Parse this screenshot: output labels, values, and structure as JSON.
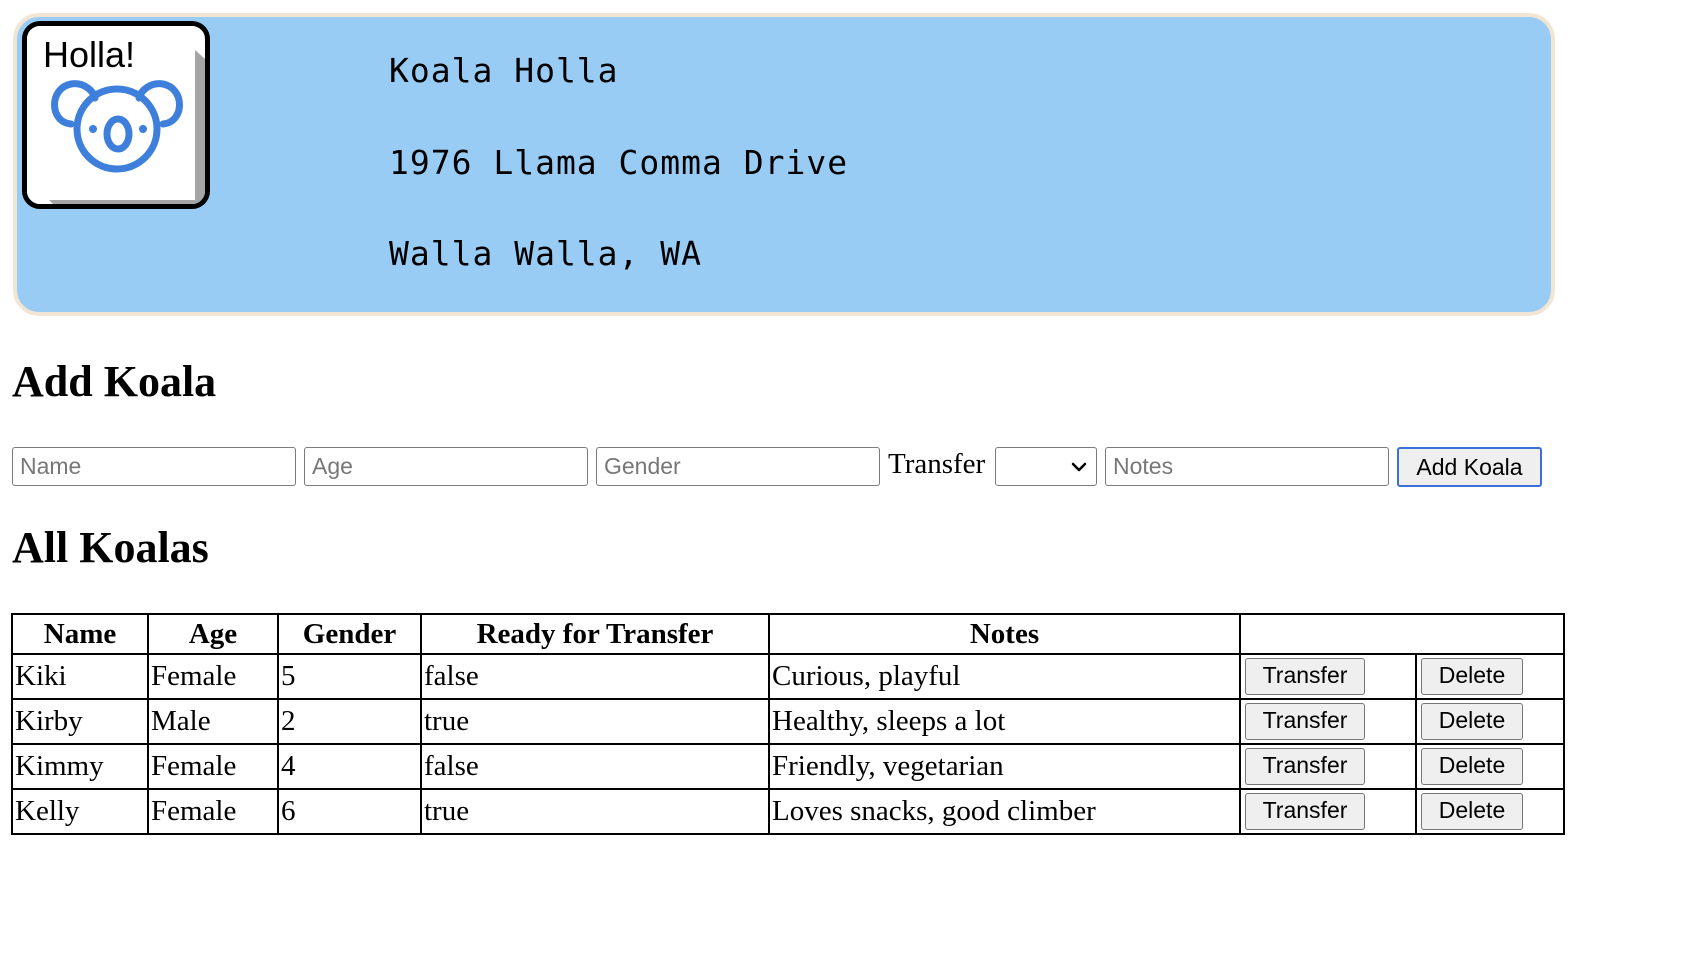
{
  "header": {
    "logo_text": "Holla!",
    "name": "Koala Holla",
    "street": "1976 Llama Comma Drive",
    "city": "Walla Walla, WA",
    "colors": {
      "banner": "#99ccf5",
      "border": "#f3e5d6",
      "koala": "#3f7fdc"
    }
  },
  "add_form": {
    "title": "Add Koala",
    "name_placeholder": "Name",
    "age_placeholder": "Age",
    "gender_placeholder": "Gender",
    "transfer_label": "Transfer",
    "transfer_selected": "",
    "notes_placeholder": "Notes",
    "submit_label": "Add Koala"
  },
  "list": {
    "title": "All Koalas",
    "columns": [
      "Name",
      "Age",
      "Gender",
      "Ready for Transfer",
      "Notes",
      ""
    ],
    "rows": [
      {
        "name": "Kiki",
        "age": "Female",
        "gender": "5",
        "ready": "false",
        "notes": "Curious, playful",
        "transfer_label": "Transfer",
        "delete_label": "Delete"
      },
      {
        "name": "Kirby",
        "age": "Male",
        "gender": "2",
        "ready": "true",
        "notes": "Healthy, sleeps a lot",
        "transfer_label": "Transfer",
        "delete_label": "Delete"
      },
      {
        "name": "Kimmy",
        "age": "Female",
        "gender": "4",
        "ready": "false",
        "notes": "Friendly, vegetarian",
        "transfer_label": "Transfer",
        "delete_label": "Delete"
      },
      {
        "name": "Kelly",
        "age": "Female",
        "gender": "6",
        "ready": "true",
        "notes": "Loves snacks, good climber",
        "transfer_label": "Transfer",
        "delete_label": "Delete"
      }
    ]
  }
}
